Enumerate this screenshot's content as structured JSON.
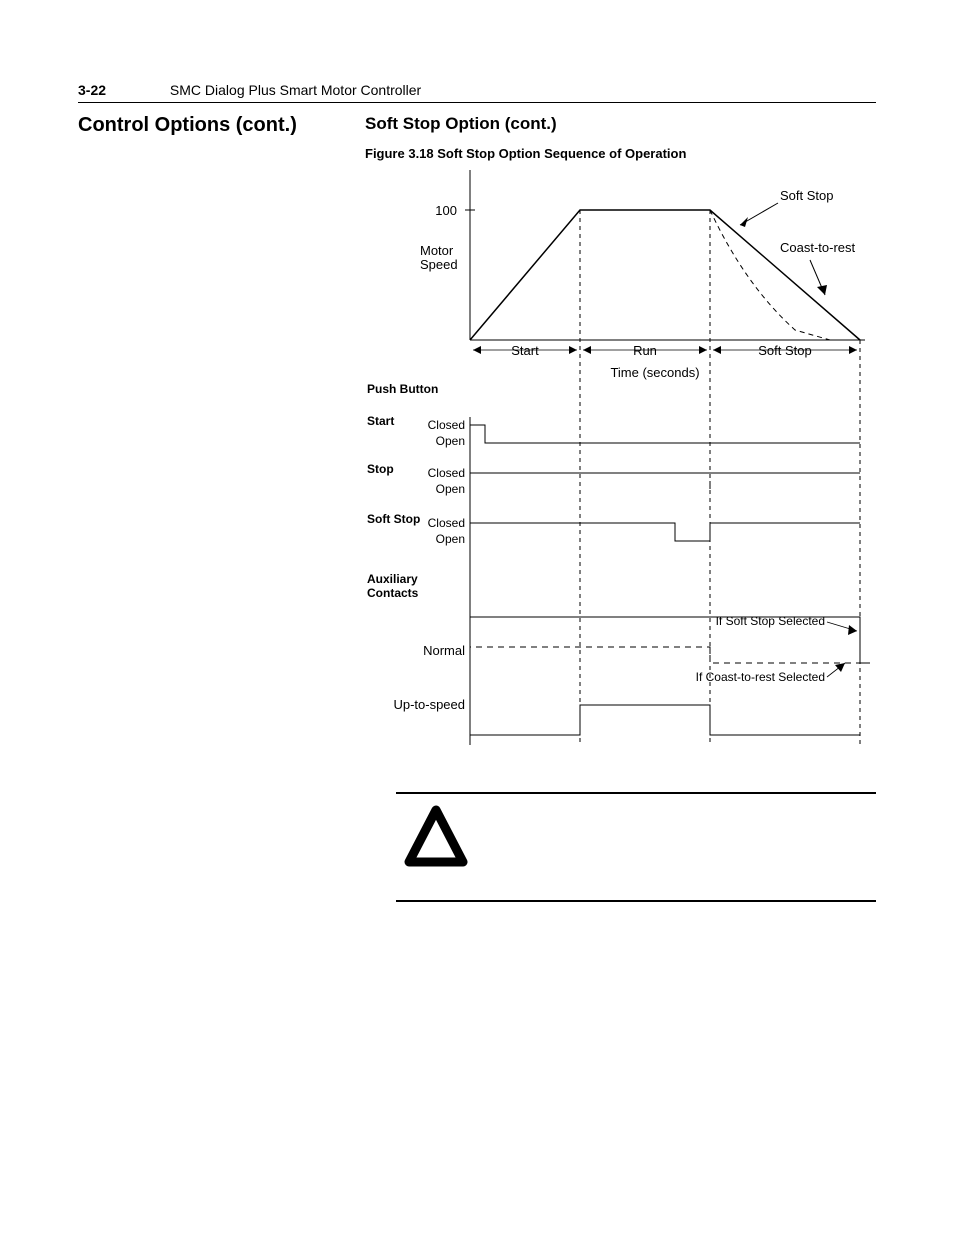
{
  "header": {
    "page_num": "3-22",
    "title": "SMC Dialog Plus Smart Motor Controller"
  },
  "headings": {
    "h1": "Control Options (cont.)",
    "h2": "Soft Stop Option (cont.)"
  },
  "figure": {
    "caption": "Figure 3.18 Soft Stop Option Sequence of Operation",
    "y_tick": "100",
    "y_label_line1": "Motor",
    "y_label_line2": "Speed",
    "curve_soft_stop": "Soft Stop",
    "curve_coast": "Coast-to-rest",
    "phase_start": "Start",
    "phase_run": "Run",
    "phase_softstop": "Soft Stop",
    "x_label": "Time (seconds)",
    "pb_heading": "Push Button",
    "pb_start": "Start",
    "pb_stop": "Stop",
    "pb_softstop": "Soft Stop",
    "state_closed": "Closed",
    "state_open": "Open",
    "aux_heading_l1": "Auxiliary",
    "aux_heading_l2": "Contacts",
    "aux_normal": "Normal",
    "aux_uts": "Up-to-speed",
    "aux_note_soft": "If Soft Stop Selected",
    "aux_note_coast": "If Coast-to-rest Selected"
  },
  "chart_data": {
    "type": "line",
    "title": "Soft Stop Option Sequence of Operation",
    "xlabel": "Time (seconds)",
    "ylabel": "Motor Speed (%)",
    "ylim": [
      0,
      100
    ],
    "x_phases": [
      "Start",
      "Run",
      "Soft Stop"
    ],
    "series": [
      {
        "name": "Soft Stop",
        "x_phase": [
          "Start begin",
          "Start end",
          "Run end",
          "Soft Stop end"
        ],
        "y": [
          0,
          100,
          100,
          0
        ],
        "style": "solid"
      },
      {
        "name": "Coast-to-rest",
        "x_phase": [
          "Run end",
          "Soft Stop mid"
        ],
        "y": [
          100,
          0
        ],
        "style": "dashed"
      }
    ],
    "timing_signals": [
      {
        "name": "Push Button Start",
        "high": "momentary at Start begin",
        "rest": "Open"
      },
      {
        "name": "Push Button Stop",
        "state": "Closed (held) entire duration"
      },
      {
        "name": "Push Button Soft Stop",
        "high": "Closed until Soft Stop begin, then Open momentarily, then Closed"
      },
      {
        "name": "Auxiliary Normal (Soft Stop selected)",
        "high": "Start begin to Soft Stop end"
      },
      {
        "name": "Auxiliary Normal (Coast-to-rest selected)",
        "high": "Start begin to Run end"
      },
      {
        "name": "Auxiliary Up-to-speed",
        "high": "Start end to Run end"
      }
    ]
  }
}
